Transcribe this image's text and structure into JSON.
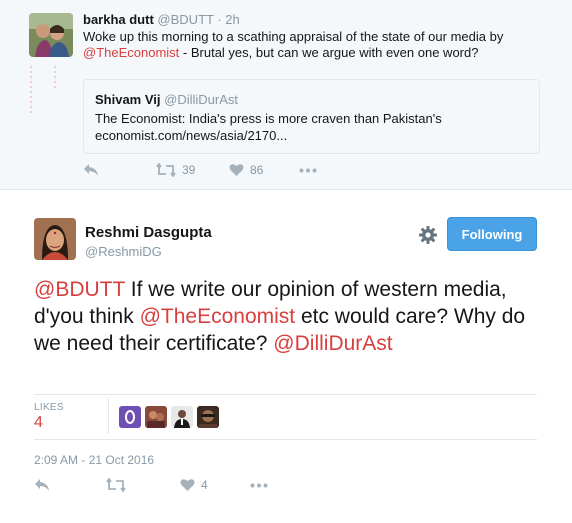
{
  "parent_tweet": {
    "name": "barkha dutt",
    "handle": "@BDUTT",
    "time": "· 2h",
    "text_line1": "Woke up this morning to a scathing appraisal of the state of our media by",
    "text_mention": "@TheEconomist",
    "text_rest": " - Brutal yes, but can we argue with even one word?",
    "quote": {
      "name": "Shivam Vij",
      "handle": "@DilliDurAst",
      "text_line1": "The Economist: India's press is more craven than Pakistan's",
      "text_line2": "economist.com/news/asia/2170..."
    },
    "retweets": "39",
    "likes": "86"
  },
  "main_tweet": {
    "name": "Reshmi Dasgupta",
    "handle": "@ReshmiDG",
    "follow_label": "Following",
    "text": {
      "mention1": "@BDUTT",
      "part1": " If we write our opinion of western media, d'you think ",
      "mention2": "@TheEconomist",
      "part2": " etc would care? Why do we need their certificate? ",
      "mention3": "@DilliDurAst"
    },
    "likes_label": "LIKES",
    "likes_count": "4",
    "timestamp": "2:09 AM - 21 Oct 2016",
    "action_likes": "4"
  },
  "icons": [
    "reply-icon",
    "retweet-icon",
    "heart-icon",
    "more-icon",
    "gear-icon"
  ],
  "colors": {
    "mention": "#d83f3f",
    "follow_button": "#4aa3e6",
    "muted": "#8899a6",
    "parent_bg": "#f5f8fa"
  }
}
